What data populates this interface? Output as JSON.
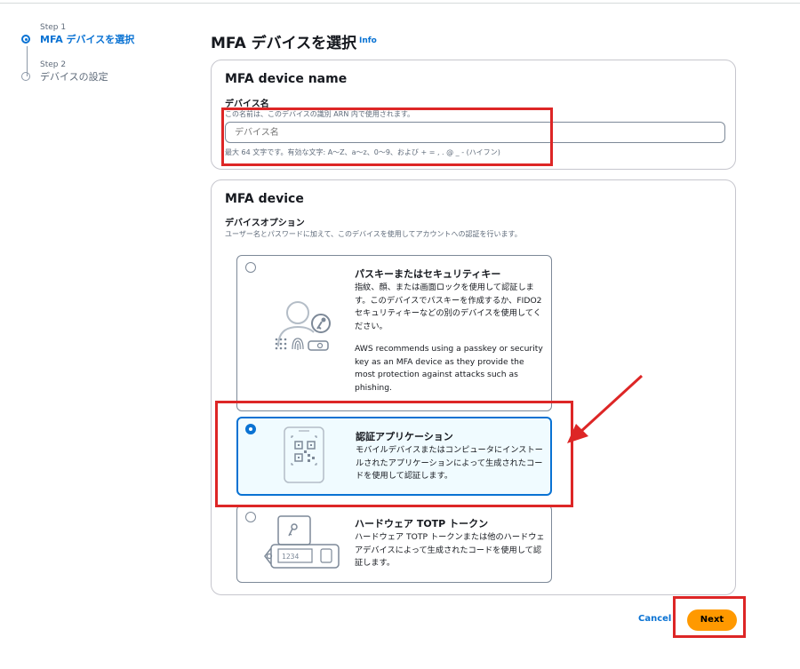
{
  "steps": [
    {
      "label": "Step 1",
      "title": "MFA デバイスを選択"
    },
    {
      "label": "Step 2",
      "title": "デバイスの設定"
    }
  ],
  "page": {
    "title": "MFA デバイスを選択",
    "info": "Info"
  },
  "name_panel": {
    "heading": "MFA device name",
    "field_label": "デバイス名",
    "field_desc": "この名前は、このデバイスの識別 ARN 内で使用されます。",
    "placeholder": "デバイス名",
    "constraint": "最大 64 文字です。有効な文字: A～Z、a～z、0～9、および + = , . @ _ - (ハイフン)"
  },
  "device_panel": {
    "heading": "MFA device",
    "options_label": "デバイスオプション",
    "options_desc": "ユーザー名とパスワードに加えて、このデバイスを使用してアカウントへの認証を行います。",
    "options": [
      {
        "title": "パスキーまたはセキュリティキー",
        "desc": "指紋、顔、または画面ロックを使用して認証します。このデバイスでパスキーを作成するか、FIDO2 セキュリティキーなどの別のデバイスを使用してください。",
        "note": "AWS recommends using a passkey or security key as an MFA device as they provide the most protection against attacks such as phishing.",
        "icon": "passkey-icon",
        "selected": false
      },
      {
        "title": "認証アプリケーション",
        "desc": "モバイルデバイスまたはコンピュータにインストールされたアプリケーションによって生成されたコードを使用して認証します。",
        "icon": "authenticator-app-icon",
        "selected": true
      },
      {
        "title": "ハードウェア TOTP トークン",
        "desc": "ハードウェア TOTP トークンまたは他のハードウェアデバイスによって生成されたコードを使用して認証します。",
        "icon": "hardware-token-icon",
        "token_digits": "1234",
        "selected": false
      }
    ]
  },
  "actions": {
    "cancel": "Cancel",
    "next": "Next"
  },
  "colors": {
    "accent": "#0972d3",
    "primary_button": "#ff9900",
    "highlight": "#dd2626"
  }
}
